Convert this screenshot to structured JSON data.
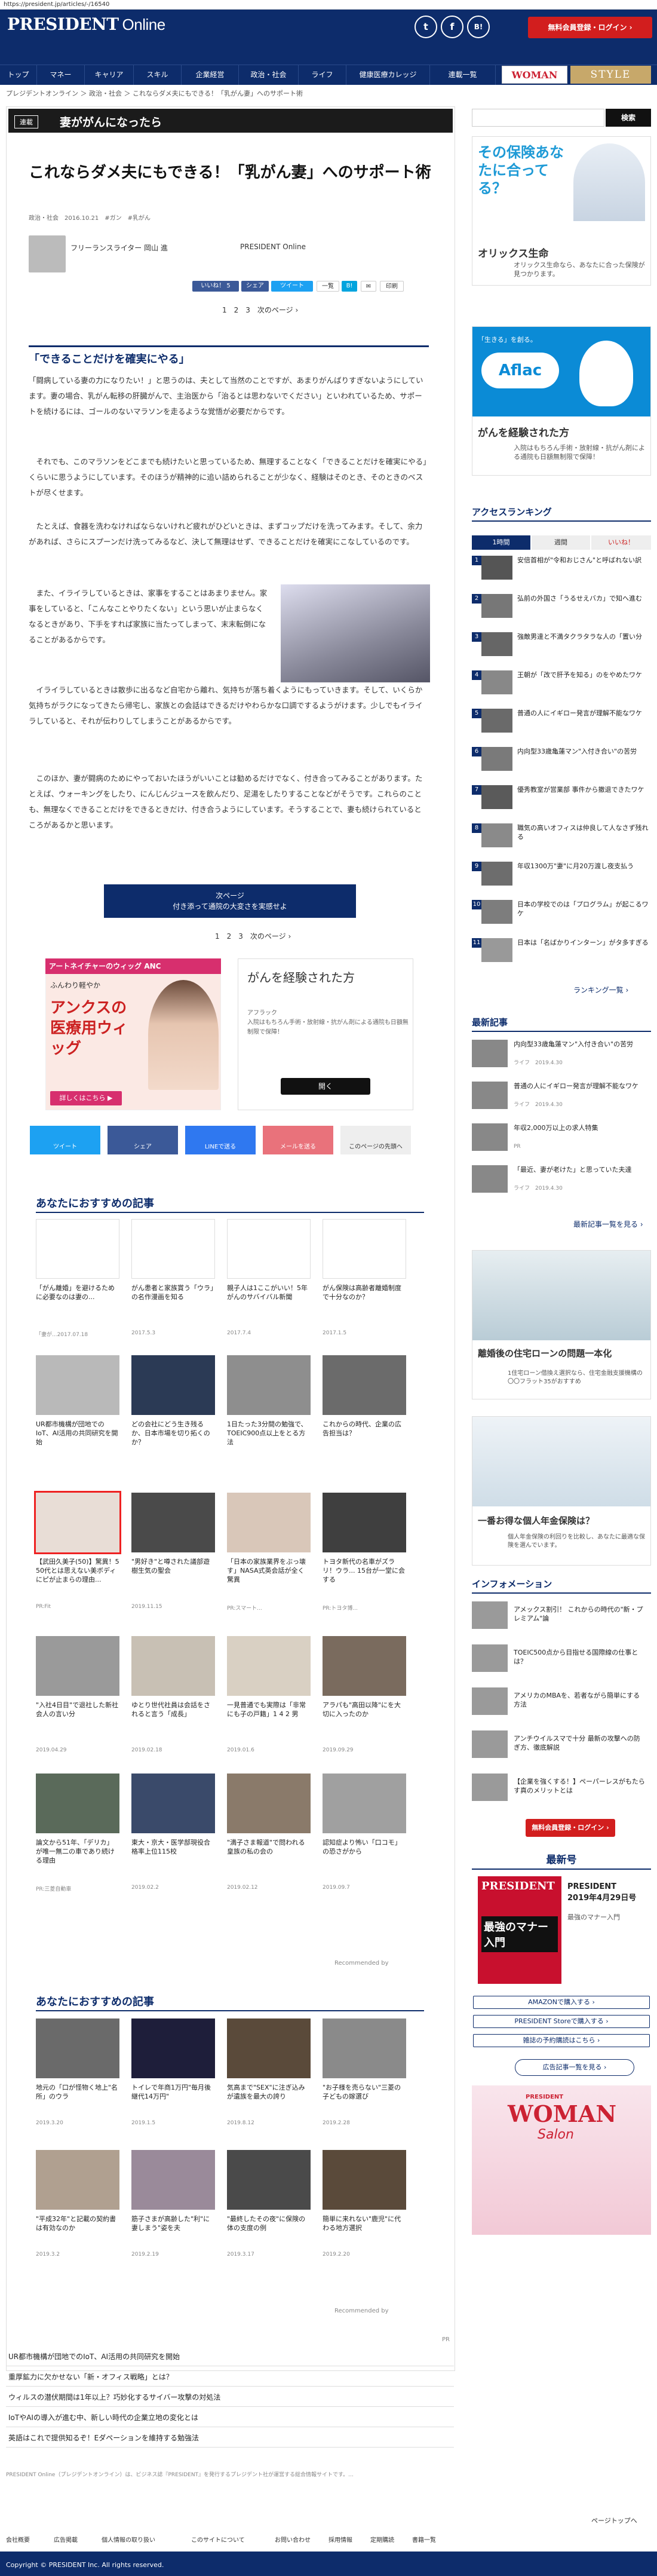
{
  "url": "https://president.jp/articles/-/16540",
  "header": {
    "logo_main": "PRESIDENT",
    "logo_sub": "Online",
    "social": [
      "t",
      "f",
      "B!"
    ],
    "login": "無料会員登録・ログイン ›"
  },
  "nav": [
    "トップ",
    "マネー",
    "キャリア",
    "スキル",
    "企業経営",
    "政治・社会",
    "ライフ",
    "健康医療カレッジ",
    "連載一覧"
  ],
  "partner_logos": [
    "WOMAN",
    "STYLE"
  ],
  "breadcrumb": "プレジデントオンライン ＞ 政治・社会 ＞ これならダメ夫にもできる！「乳がん妻」へのサポート術",
  "serial": {
    "tag": "連載",
    "title": "妻ががんになったら"
  },
  "article": {
    "title": "これならダメ夫にもできる！「乳がん妻」へのサポート術",
    "meta": "政治・社会　2016.10.21　#ガン　#乳がん",
    "author": "フリーランスライター 岡山 進",
    "publisher": "PRESIDENT Online",
    "share": [
      "いいね！ 5",
      "シェア",
      "ツイート",
      "一覧",
      "B!",
      "✉",
      "印刷"
    ],
    "pager": "1　2　3　次のページ ›",
    "subhead": "「できることだけを確実にやる」",
    "paragraphs": [
      "「闘病している妻の力になりたい！」と思うのは、夫として当然のことですが、あまりがんばりすぎないようにしています。妻の場合、乳がん転移の肝臓がんで、主治医から「治るとは思わないでください」といわれているため、サポートを続けるには、ゴールのないマラソンを走るような覚悟が必要だからです。",
      "　それでも、このマラソンをどこまでも続けたいと思っているため、無理することなく「できることだけを確実にやる」くらいに思うようにしています。そのほうが精神的に追い詰められることが少なく、経験はそのとき、そのときのベストが尽くせます。",
      "　たとえば、食器を洗わなければならないけれど疲れがひどいときは、まずコップだけを洗ってみます。そして、余力があれば、さらにスプーンだけ洗ってみるなど、決して無理はせず、できることだけを確実にこなしているのです。",
      "　また、イライラしているときは、家事をすることはあまりません。家事をしていると、「こんなことやりたくない」という思いが止まらなくなるときがあり、下手をすれば家族に当たってしまって、末末転倒になることがあるからです。",
      "　イライラしているときは散歩に出るなど自宅から離れ、気持ちが落ち着くようにもっていきます。そして、いくらか気持ちがラクになってきたら帰宅し、家族との会話はできるだけやわらかな口調でするようがけます。少しでもイライラしていると、それが伝わりしてしまうことがあるからです。",
      "　このほか、妻が闘病のためにやっておいたほうがいいことは勧めるだけでなく、付き合ってみることがあります。たとえば、ウォーキングをしたり、にんじんジュースを飲んだり、足湯をしたりすることなどがそうです。これらのことも、無理なくできることだけをできるときだけ、付き合うようにしています。そうすることで、妻も続けられているところがあるかと思います。"
    ],
    "next_label": "次ページ",
    "next_title": "付き添って通院の大変さを実感せよ",
    "pager_bottom": "1　2　3　次のページ ›"
  },
  "ads": {
    "aderans_head": "アートネイチャーのウィッグ ANC",
    "aderans_text": "ふんわり軽やか",
    "aderans_big": "アンクスの医療用ウィッグ",
    "aderans_btn": "詳しくはこちら ▶",
    "cancer_title": "がんを経験された方",
    "cancer_sub": "アフラック\n入院はもちろん手術・放射線・抗がん剤による通院も日額無制限で保障！",
    "cancer_btn": "開く"
  },
  "sns_bar": [
    "ツイート",
    "シェア",
    "LINEで送る",
    "メールを送る",
    "このページの先頭へ"
  ],
  "rec1": {
    "title": "あなたにおすすめの記事",
    "row1": [
      {
        "t": "「がん離婚」を避けるために必要なのは妻の...",
        "s": "「妻が...2017.07.18"
      },
      {
        "t": "がん患者と家族賞う「ウラ」の名作漫画を知る",
        "s": "2017.5.3"
      },
      {
        "t": "親子人は1ここがいい！5年がんのサバイバル新聞",
        "s": "2017.7.4"
      },
      {
        "t": "がん保険は高齢者離婚制度で十分なのか？",
        "s": "2017.1.5"
      }
    ],
    "row2": [
      {
        "t": "UR都市機構が団地でのIoT、AI活用の共同研究を開始",
        "s": ""
      },
      {
        "t": "どの会社にどう生き残るか、日本市場を切り拓くのか？",
        "s": ""
      },
      {
        "t": "1日たった3分間の勉強で、TOEIC900点以上をとる方法",
        "s": ""
      },
      {
        "t": "これからの時代、企業の広告担当は？",
        "s": ""
      }
    ],
    "row3": [
      {
        "t": "【武田久美子(50)】驚異！5 50代とは思えない美ボディにピが止まらの理由...",
        "s": "PR:Fit"
      },
      {
        "t": "\"男好き\"と噂された議部遊樹生気の聖会",
        "s": "2019.11.15"
      },
      {
        "t": "「日本の家族業界をぶっ壊す」NASA式英会話が全く驚異",
        "s": "PR:スマート..."
      },
      {
        "t": "トヨタ新代の名車がズラリ！ウラ... 15台が一堂に会する",
        "s": "PR:トヨタ博..."
      }
    ],
    "row4": [
      {
        "t": "\"入社4日目\"で退社した新社会人の言い分",
        "s": "2019.04.29"
      },
      {
        "t": "ゆとり世代社員は会話をされると言う「成長」",
        "s": "2019.02.18"
      },
      {
        "t": "一見普通でも実際は「非常にも子の戸籍」1 4 2 男",
        "s": "2019.01.6"
      },
      {
        "t": "アラパも\"高田以降\"にを大切に入ったのか",
        "s": "2019.09.29"
      }
    ],
    "row5": [
      {
        "t": "論文から51年、「デリカ」が唯一無二の車であり続ける理由",
        "s": "PR:三菱自動車"
      },
      {
        "t": "東大・京大・医学部現役合格率上位115校",
        "s": "2019.02.2"
      },
      {
        "t": "\"満子さま報道\"で問われる皇族の私の会の",
        "s": "2019.02.12"
      },
      {
        "t": "認知症より怖い「口コモ」の恐さがから",
        "s": "2019.09.7"
      }
    ],
    "recommended_by": "Recommended by"
  },
  "rec2": {
    "title": "あなたにおすすめの記事",
    "row1": [
      {
        "t": "地元の「口が怪物く地上\"名所」のウラ",
        "s": "2019.3.20"
      },
      {
        "t": "トイレで年商1万円\"毎月後継代14万円\"",
        "s": "2019.1.5"
      },
      {
        "t": "気高まで\"SEX\"に注ぎ込みが遺族を最大の誇り",
        "s": "2019.8.12"
      },
      {
        "t": "\"お子様を売らない\"三菱の子どもの嫁選び",
        "s": "2019.2.28"
      }
    ],
    "row2": [
      {
        "t": "\"平成32年\"と記載の契約書は有効なのか",
        "s": "2019.3.2"
      },
      {
        "t": "筋子さまが高齢した\"利\"に妻しまう\"姿を夫",
        "s": "2019.2.19"
      },
      {
        "t": "\"最終したその夜\"に保険の体の支度の例",
        "s": "2019.3.17"
      },
      {
        "t": "簡単に来れない\"鹿児\"に代わる地方選択",
        "s": "2019.2.20"
      }
    ],
    "recommended_by": "Recommended by"
  },
  "related": [
    "UR都市機構が団地でのIoT、AI活用の共同研究を開始",
    "重厚鉱力に欠かせない「新・オフィス戦略」とは？",
    "ウィルスの潜伏期間は1年以上？巧妙化するサイバー攻撃の対処法",
    "IoTやAIの導入が進む中、新しい時代の企業立地の変化とは",
    "英語はこれで提供知るぞ！Eダペーションを維持する勉強法"
  ],
  "related_pr": "PR",
  "bottom_text": "PRESIDENT Online（プレジデントオンライン）は、ビジネス誌『PRESIDENT』を発行するプレジデント社が運営する総合情報サイトです。...",
  "page_top": "ページトップへ",
  "footer": [
    "会社概要",
    "広告掲載",
    "個人情報の取り扱い",
    "このサイトについて",
    "お問い合わせ",
    "採用情報",
    "定期購読",
    "書籍一覧"
  ],
  "copyright": "Copyright © PRESIDENT Inc. All rights reserved.",
  "sidebar": {
    "search": "検索",
    "orix": {
      "headline": "その保険あなたに合ってる？",
      "brand": "オリックス生命",
      "desc": "オリックス生命なら、あなたに合った保険が見つかります。"
    },
    "aflac": {
      "headline": "「生きる」を創る。",
      "brand": "Aflac",
      "title": "がんを経験された方",
      "desc": "入院はもちろん手術・放射線・抗がん剤による通院も日額無制限で保障！"
    },
    "ranking_title": "アクセスランキング",
    "ranking_tabs": [
      "1時間",
      "週間",
      "いいね！"
    ],
    "ranking": [
      "安倍首相が\"令和おじさん\"と呼ばれない訳",
      "弘前の外国さ「うるせえバカ」で知へ進む",
      "強敵男達と不満タクラタラな人の「置い分",
      "王朝が「改で肝予を知る」のをやめたワケ",
      "普通の人にイギロー発言が理解不能なワケ",
      "内向型33歳亀蓮マン\"入付き合い\"の苦労",
      "優秀教室が営業部 事件から撤退できたワケ",
      "職気の高いオフィスは仲良して人なさず残れる",
      "年収1300万\"妻\"に月20万渡し夜支払う",
      "日本の学校でのは「プログラム」が起こるワケ",
      "日本は「名ばかりインターン」がタ多すぎる"
    ],
    "ranking_more": "ランキング一覧 ›",
    "latest_title": "最新記事",
    "latest": [
      {
        "t": "内向型33歳亀蓮マン\"入付き合い\"の苦労",
        "s": "ライフ　2019.4.30"
      },
      {
        "t": "普通の人にイギロー発言が理解不能なワケ",
        "s": "ライフ　2019.4.30"
      },
      {
        "t": "年収2,000万以上の求人特集",
        "s": "PR"
      },
      {
        "t": "「最近、妻が老けた」と思っていた夫達",
        "s": "ライフ　2019.4.30"
      }
    ],
    "latest_more": "最新記事一覧を見る ›",
    "jmp_ad": {
      "title": "離婚後の住宅ローンの問題一本化",
      "desc": "1住宅ローン借換え選択なら、住宅金融支援機構の〇〇フラット35がおすすめ"
    },
    "pension_ad": {
      "title": "一番お得な個人年金保険は？",
      "desc": "個人年金保険の利回りを比較し、あなたに最適な保険を選んでいます。"
    },
    "info_title": "インフォメーション",
    "info": [
      "アメックス割引！ これからの時代の\"新・プレミアム\"論",
      "TOEIC500点から目指せる国際線の仕事とは？",
      "アメリカのMBAを、若者ながら簡単にする方法",
      "アンチウイルスマで十分 最新の攻撃への防ぎ方、徹底解説",
      "【企業を強くする！】ペーパーレスがもたらす真のメリットとは"
    ],
    "login": "無料会員登録・ログイン ›",
    "issue_title": "最新号",
    "issue": {
      "brand": "PRESIDENT",
      "name": "PRESIDENT\n2019年4月29日号",
      "cover_text": "最強のマナー入門",
      "desc": "最強のマナー入門"
    },
    "issue_buttons": [
      "AMAZONで購入する ›",
      "PRESIDENT Storeで購入する ›",
      "雑誌の予約購読はこちら ›"
    ],
    "ad_button": "広告記事一覧を見る ›",
    "woman_salon": {
      "brand": "PRESIDENT",
      "name": "WOMAN",
      "sub": "Salon"
    }
  }
}
